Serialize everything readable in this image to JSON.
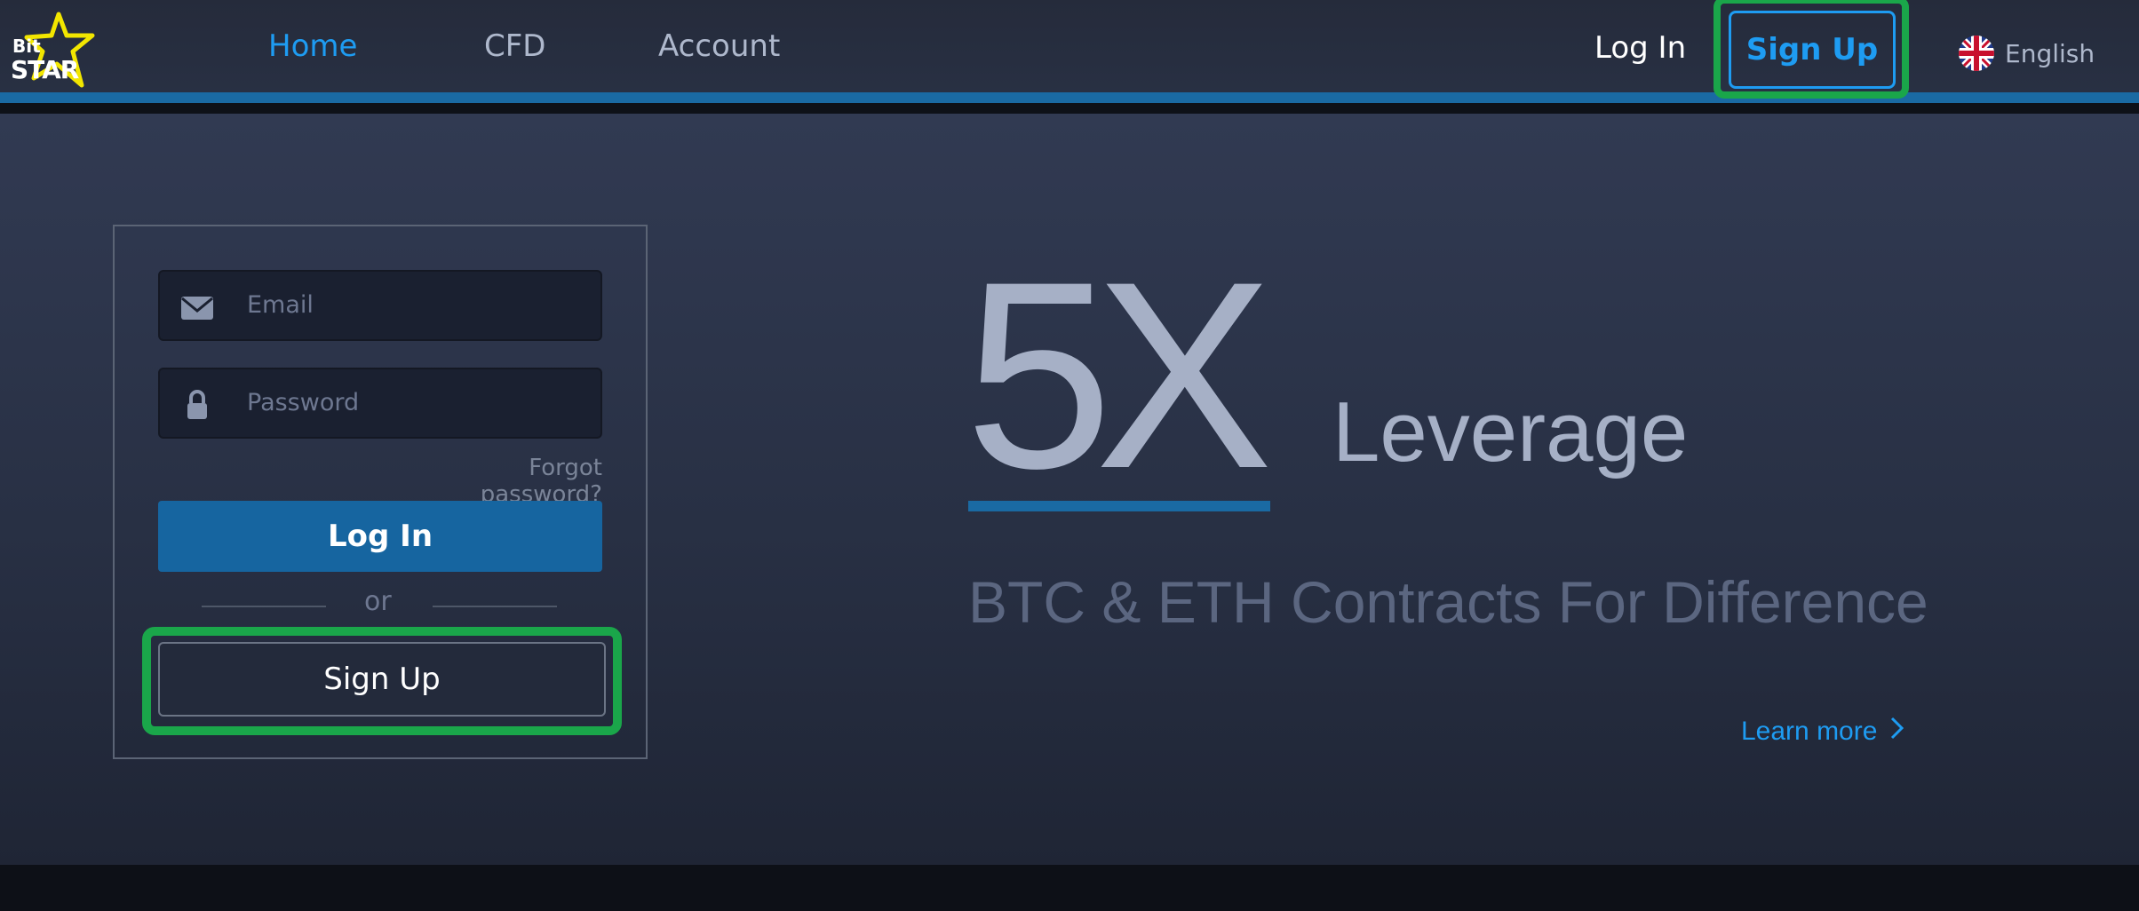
{
  "brand": {
    "line1": "Bit",
    "line2": "STAR"
  },
  "nav": {
    "home": "Home",
    "cfd": "CFD",
    "account": "Account",
    "login": "Log In",
    "signup": "Sign Up",
    "language": "English"
  },
  "form": {
    "email_placeholder": "Email",
    "password_placeholder": "Password",
    "forgot": "Forgot password?",
    "login_button": "Log In",
    "or": "or",
    "signup_button": "Sign Up"
  },
  "hero": {
    "big": "5X",
    "word": "Leverage",
    "subtitle": "BTC & ETH Contracts For Difference",
    "learn_more": "Learn more"
  },
  "colors": {
    "accent": "#1e9cf2",
    "highlight": "#1aa64a",
    "bar": "#1a6aa3"
  },
  "icons": [
    "star-logo-icon",
    "uk-flag-icon",
    "envelope-icon",
    "lock-icon",
    "chevron-right-icon"
  ]
}
